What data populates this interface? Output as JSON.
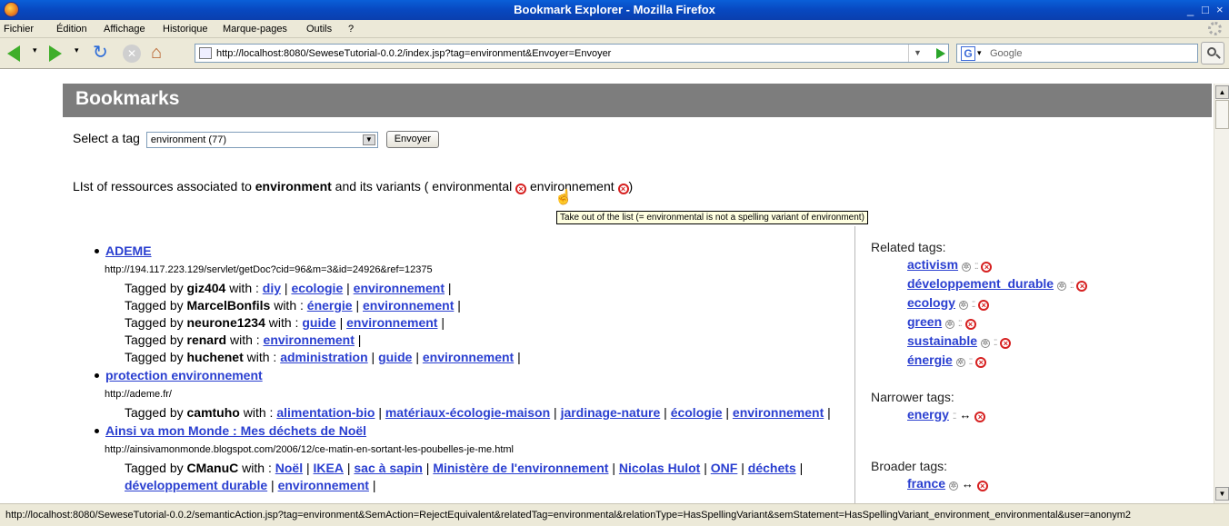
{
  "window": {
    "title": "Bookmark Explorer - Mozilla Firefox",
    "controls": [
      "_",
      "□",
      "×"
    ]
  },
  "menu": [
    "Fichier",
    "Édition",
    "Affichage",
    "Historique",
    "Marque-pages",
    "Outils",
    "?"
  ],
  "nav": {
    "url": "http://localhost:8080/SeweseTutorial-0.0.2/index.jsp?tag=environment&Envoyer=Envoyer",
    "search_placeholder": "Google"
  },
  "page": {
    "header": "Bookmarks",
    "select_label": "Select a tag",
    "select_value": "environment (77)",
    "submit_label": "Envoyer",
    "intro_pre": "LIst of ressources associated to",
    "intro_tag": "environment",
    "intro_mid": "and its variants (",
    "variant1": "environmental",
    "variant2": "environnement",
    "intro_end": ")",
    "tooltip": "Take out of the list (= environmental is not a spelling variant of environment)"
  },
  "resources": [
    {
      "title": "ADEME",
      "url": "http://194.117.223.129/servlet/getDoc?cid=96&m=3&id=24926&ref=12375",
      "taggings": [
        {
          "user": "giz404",
          "tags": [
            "diy",
            "ecologie",
            "environnement"
          ]
        },
        {
          "user": "MarcelBonfils",
          "tags": [
            "énergie",
            "environnement"
          ]
        },
        {
          "user": "neurone1234",
          "tags": [
            "guide",
            "environnement"
          ]
        },
        {
          "user": "renard",
          "tags": [
            "environnement"
          ]
        },
        {
          "user": "huchenet",
          "tags": [
            "administration",
            "guide",
            "environnement"
          ]
        }
      ]
    },
    {
      "title": "protection environnement",
      "url": "http://ademe.fr/",
      "taggings": [
        {
          "user": "camtuho",
          "tags": [
            "alimentation-bio",
            "matériaux-écologie-maison",
            "jardinage-nature",
            "écologie",
            "environnement"
          ]
        }
      ]
    },
    {
      "title": "Ainsi va mon Monde : Mes déchets de Noël",
      "url": "http://ainsivamonmonde.blogspot.com/2006/12/ce-matin-en-sortant-les-poubelles-je-me.html",
      "taggings": [
        {
          "user": "CManuC",
          "tags": [
            "Noël",
            "IKEA",
            "sac à sapin",
            "Ministère de l'environnement",
            "Nicolas Hulot",
            "ONF",
            "déchets",
            "développement durable",
            "environnement"
          ]
        }
      ]
    }
  ],
  "sidebar": {
    "related_label": "Related tags:",
    "related": [
      "activism",
      "développement_durable",
      "ecology",
      "green",
      "sustainable",
      "énergie"
    ],
    "narrower_label": "Narrower tags:",
    "narrower": [
      "energy"
    ],
    "broader_label": "Broader tags:",
    "broader": [
      "france"
    ]
  },
  "labels": {
    "tagged_by": "Tagged by",
    "with": "with :"
  },
  "status": {
    "text": "http://localhost:8080/SeweseTutorial-0.0.2/semanticAction.jsp?tag=environment&SemAction=RejectEquivalent&relatedTag=environmental&relationType=HasSpellingVariant&semStatement=HasSpellingVariant_environment_environmental&user=anonym2"
  }
}
